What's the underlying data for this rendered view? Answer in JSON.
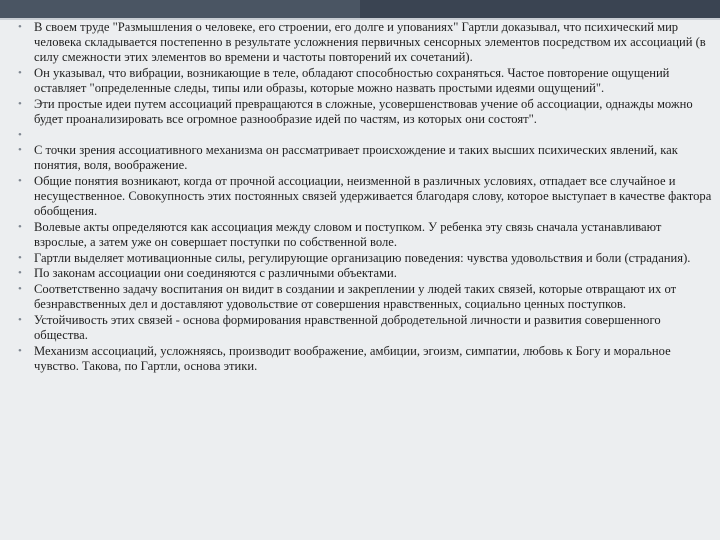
{
  "slide": {
    "bullet_symbol": "•",
    "items": [
      "В своем труде \"Размышления о человеке, его строении, его долге и упованиях\" Гартли доказывал, что  психический мир человека складывается постепенно в результате усложнения первичных сенсорных элементов посредством их ассоциаций (в силу смежности этих элементов во времени и частоты повторений их сочетаний).",
      "Он указывал, что вибрации, возникающие в теле, обладают способностью сохраняться. Частое повторение ощущений оставляет \"определенные следы, типы или образы, которые можно назвать простыми идеями ощущений\".",
      "Эти простые идеи путем ассоциаций превращаются в сложные, усовершенствовав учение об ассоциации, однажды можно будет проанализировать все огромное разнообразие идей по частям, из которых они состоят\".",
      "",
      "С точки зрения ассоциативного механизма он рассматривает происхождение и таких высших психических явлений, как понятия, воля, воображение.",
      "Общие понятия возникают, когда от прочной ассоциации, неизменной в различных условиях, отпадает все случайное и несущественное. Совокупность этих постоянных связей удерживается благодаря слову, которое выступает в качестве фактора обобщения.",
      "Волевые акты определяются как ассоциация между словом и поступком. У ребенка эту связь сначала устанавливают взрослые, а затем уже он совершает поступки по собственной воле.",
      "Гартли выделяет мотивационные силы, регулирующие организацию поведения: чувства удовольствия и боли (страдания).",
      "По законам ассоциации они соединяются с различными объектами.",
      "Соответственно задачу воспитания он видит в создании и закреплении у людей таких связей, которые отвращают их от безнравственных дел и доставляют удовольствие от совершения нравственных, социально ценных поступков.",
      "Устойчивость этих связей - основа формирования нравственной добродетельной личности и развития совершенного общества.",
      "Механизм ассоциаций, усложняясь, производит воображение, амбиции, эгоизм, симпатии, любовь к Богу и моральное чувство. Такова, по Гартли, основа этики."
    ]
  }
}
